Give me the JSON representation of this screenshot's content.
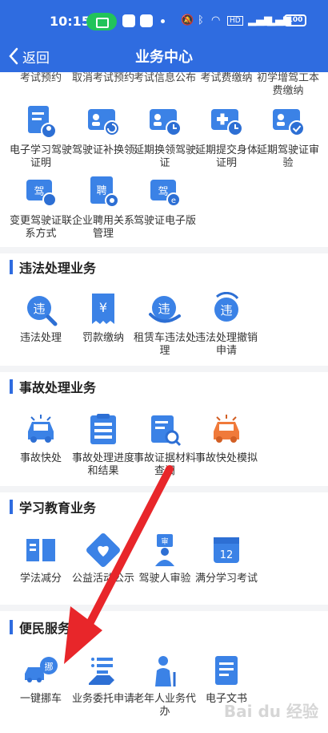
{
  "statusbar": {
    "time": "10:15",
    "battery": "100"
  },
  "navbar": {
    "back_label": "返回",
    "title": "业务中心"
  },
  "partial_row": [
    "考试预约",
    "取消考试预约",
    "考试信息公布",
    "考试费缴纳",
    "初学增驾工本费缴纳"
  ],
  "top_items": [
    {
      "label": "电子学习驾驶证明",
      "icon": "doc-user-icon"
    },
    {
      "label": "驾驶证补换领",
      "icon": "card-refresh-icon"
    },
    {
      "label": "延期换领驾驶证",
      "icon": "card-clock-icon"
    },
    {
      "label": "延期提交身体证明",
      "icon": "medical-clock-icon"
    },
    {
      "label": "延期驾驶证审验",
      "icon": "card-check-icon"
    },
    {
      "label": "变更驾驶证联系方式",
      "icon": "license-phone-icon"
    },
    {
      "label": "企业聘用关系管理",
      "icon": "hire-gear-icon"
    },
    {
      "label": "驾驶证电子版",
      "icon": "license-e-icon"
    }
  ],
  "sections": {
    "violation": {
      "title": "违法处理业务",
      "items": [
        {
          "label": "违法处理",
          "icon": "violation-search-icon"
        },
        {
          "label": "罚款缴纳",
          "icon": "fine-receipt-icon"
        },
        {
          "label": "租赁车违法处理",
          "icon": "rental-violation-icon"
        },
        {
          "label": "违法处理撤销申请",
          "icon": "violation-revoke-icon"
        }
      ]
    },
    "accident": {
      "title": "事故处理业务",
      "items": [
        {
          "label": "事故快处",
          "icon": "car-crash-icon"
        },
        {
          "label": "事故处理进度和结果",
          "icon": "progress-list-icon"
        },
        {
          "label": "事故证据材料查阅",
          "icon": "evidence-search-icon"
        },
        {
          "label": "事故快处模拟",
          "icon": "crash-sim-icon"
        }
      ]
    },
    "education": {
      "title": "学习教育业务",
      "items": [
        {
          "label": "学法减分",
          "icon": "book-icon"
        },
        {
          "label": "公益活动公示",
          "icon": "heart-hand-icon"
        },
        {
          "label": "驾驶人审验",
          "icon": "inspector-icon"
        },
        {
          "label": "满分学习考试",
          "icon": "calendar-12-icon"
        }
      ]
    },
    "convenience": {
      "title": "便民服务",
      "items": [
        {
          "label": "一键挪车",
          "icon": "move-car-icon"
        },
        {
          "label": "业务委托申请",
          "icon": "entrust-icon"
        },
        {
          "label": "老年人业务代办",
          "icon": "elderly-icon"
        },
        {
          "label": "电子文书",
          "icon": "e-document-icon"
        }
      ]
    }
  },
  "colors": {
    "brand": "#2f6ce0",
    "icon_blue": "#3b82e6",
    "accent_orange": "#f07a3a",
    "annotation_red": "#e8262a"
  },
  "watermark": "Bai du 经验"
}
